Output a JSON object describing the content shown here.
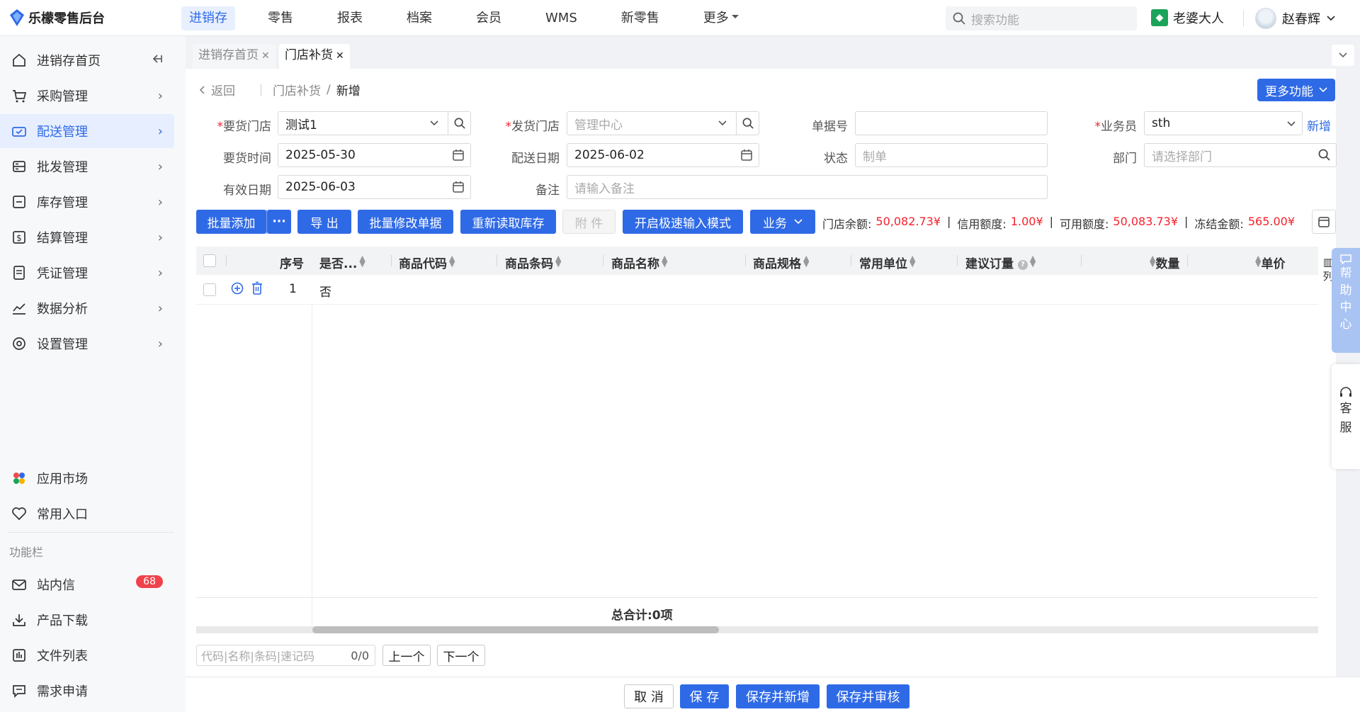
{
  "app": {
    "title": "乐檬零售后台"
  },
  "topnav": {
    "items": [
      "进销存",
      "零售",
      "报表",
      "档案",
      "会员",
      "WMS",
      "新零售",
      "更多"
    ]
  },
  "search": {
    "placeholder": "搜索功能"
  },
  "shop": {
    "name": "老婆大人"
  },
  "user": {
    "name": "赵春辉"
  },
  "sidebar": {
    "items": [
      {
        "label": "进销存首页",
        "icon": "home-icon"
      },
      {
        "label": "采购管理",
        "icon": "cart-icon"
      },
      {
        "label": "配送管理",
        "icon": "truck-icon"
      },
      {
        "label": "批发管理",
        "icon": "wholesale-icon"
      },
      {
        "label": "库存管理",
        "icon": "inventory-icon"
      },
      {
        "label": "结算管理",
        "icon": "money-icon"
      },
      {
        "label": "凭证管理",
        "icon": "voucher-icon"
      },
      {
        "label": "数据分析",
        "icon": "chart-icon"
      },
      {
        "label": "设置管理",
        "icon": "settings-icon"
      }
    ],
    "bottom_items": [
      {
        "label": "应用市场",
        "icon": "app-market-icon"
      },
      {
        "label": "常用入口",
        "icon": "heart-icon"
      }
    ],
    "section_label": "功能栏",
    "tool_items": [
      {
        "label": "站内信",
        "icon": "mail-icon",
        "badge": "68"
      },
      {
        "label": "产品下载",
        "icon": "download-icon"
      },
      {
        "label": "文件列表",
        "icon": "file-list-icon"
      },
      {
        "label": "需求申请",
        "icon": "request-icon"
      }
    ]
  },
  "tabs": [
    {
      "label": "进销存首页"
    },
    {
      "label": "门店补货"
    }
  ],
  "breadcrumb": {
    "back": "返回",
    "parent": "门店补货",
    "separator": "/",
    "current": "新增"
  },
  "more_func": {
    "label": "更多功能"
  },
  "form": {
    "request_store": {
      "label": "要货门店",
      "value": "测试1"
    },
    "ship_store": {
      "label": "发货门店",
      "placeholder": "管理中心"
    },
    "doc_no": {
      "label": "单据号",
      "value": ""
    },
    "salesman": {
      "label": "业务员",
      "value": "sth",
      "add_label": "新增"
    },
    "request_time": {
      "label": "要货时间",
      "value": "2025-05-30"
    },
    "delivery_date": {
      "label": "配送日期",
      "value": "2025-06-02"
    },
    "status": {
      "label": "状态",
      "placeholder": "制单"
    },
    "department": {
      "label": "部门",
      "placeholder": "请选择部门"
    },
    "valid_date": {
      "label": "有效日期",
      "value": "2025-06-03"
    },
    "remark": {
      "label": "备注",
      "placeholder": "请输入备注"
    }
  },
  "toolbar": {
    "batch_add": "批量添加",
    "more_dots": "···",
    "export": "导 出",
    "batch_edit": "批量修改单据",
    "reload_stock": "重新读取库存",
    "attachment": "附 件",
    "fast_input": "开启极速输入模式",
    "business": "业务"
  },
  "balances": {
    "store_balance_label": "门店余额:",
    "store_balance": "50,082.73¥",
    "credit_label": "信用额度:",
    "credit": "1.00¥",
    "available_label": "可用额度:",
    "available": "50,083.73¥",
    "frozen_label": "冻结金额:",
    "frozen": "565.00¥"
  },
  "table": {
    "columns": [
      "序号",
      "是否...",
      "商品代码",
      "商品条码",
      "商品名称",
      "商品规格",
      "常用单位",
      "建议订量",
      "数量",
      "单价"
    ],
    "rows": [
      {
        "index": "1",
        "flag": "否"
      }
    ],
    "column_toggle": "列",
    "total": "总合计:0项"
  },
  "finder": {
    "placeholder": "代码|名称|条码|速记码",
    "count": "0/0",
    "prev": "上一个",
    "next": "下一个"
  },
  "footer": {
    "cancel": "取 消",
    "save": "保 存",
    "save_new": "保存并新增",
    "save_audit": "保存并审核"
  },
  "float_panels": {
    "help": [
      "帮",
      "助",
      "中",
      "心"
    ],
    "service": [
      "客",
      "服"
    ]
  },
  "colors": {
    "primary": "#2f6ae6",
    "danger": "#f5222d",
    "shop_green": "#1aa35a",
    "badge": "#f0424b"
  }
}
